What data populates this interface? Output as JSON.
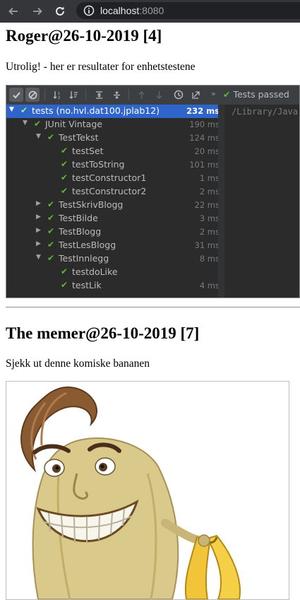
{
  "browser": {
    "url_host": "localhost",
    "url_port": ":8080",
    "back_icon": "arrow-left-icon",
    "forward_icon": "arrow-right-icon",
    "reload_icon": "reload-icon",
    "info_icon": "info-circle-icon"
  },
  "posts": [
    {
      "title": "Roger@26-10-2019 [4]",
      "text": "Utrolig! - her er resultater for enhetstestene"
    },
    {
      "title": "The memer@26-10-2019 [7]",
      "text": "Sjekk ut denne komiske bananen"
    }
  ],
  "test_runner": {
    "status": "Tests passed",
    "console_path": "/Library/Java",
    "toolbar_icons": [
      "check-icon",
      "stop-icon",
      "sort-alpha-icon",
      "sort-duration-icon",
      "expand-all-icon",
      "collapse-all-icon",
      "up-arrow-icon",
      "down-arrow-icon",
      "history-icon",
      "export-icon",
      "more-icon"
    ],
    "rows": [
      {
        "label": "tests (no.hvl.dat100.jplab12)",
        "time": "232 ms",
        "arrow": "▼",
        "selected": true
      },
      {
        "label": "JUnit Vintage",
        "time": "190 ms",
        "arrow": "▼"
      },
      {
        "label": "TestTekst",
        "time": "124 ms",
        "arrow": "▼"
      },
      {
        "label": "testSet",
        "time": "20 ms"
      },
      {
        "label": "testToString",
        "time": "101 ms"
      },
      {
        "label": "testConstructor1",
        "time": "1 ms"
      },
      {
        "label": "testConstructor2",
        "time": "2 ms"
      },
      {
        "label": "TestSkrivBlogg",
        "time": "22 ms",
        "arrow": "▶"
      },
      {
        "label": "TestBilde",
        "time": "3 ms",
        "arrow": "▶"
      },
      {
        "label": "TestBlogg",
        "time": "2 ms",
        "arrow": "▶"
      },
      {
        "label": "TestLesBlogg",
        "time": "31 ms",
        "arrow": "▶"
      },
      {
        "label": "TestInnlegg",
        "time": "8 ms",
        "arrow": "▼"
      },
      {
        "label": "testdoLike",
        "time": ""
      },
      {
        "label": "testLik",
        "time": "4 ms"
      }
    ]
  },
  "colors": {
    "chrome": "#35363a",
    "ide_bg": "#2b2b2b",
    "selection": "#2f65ca",
    "pass_green": "#5fb832"
  }
}
